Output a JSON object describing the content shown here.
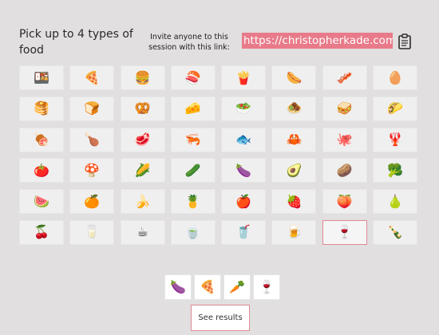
{
  "header": {
    "title": "Pick up to 4 types of food",
    "invite_text": "Invite anyone to this session with this link:",
    "link": "https://christopherkade.com",
    "copy_icon": "clipboard-icon"
  },
  "foods": [
    {
      "name": "bento-box",
      "emoji": "🍱"
    },
    {
      "name": "pizza",
      "emoji": "🍕"
    },
    {
      "name": "hamburger",
      "emoji": "🍔"
    },
    {
      "name": "sushi",
      "emoji": "🍣"
    },
    {
      "name": "french-fries",
      "emoji": "🍟"
    },
    {
      "name": "hot-dog",
      "emoji": "🌭"
    },
    {
      "name": "bacon",
      "emoji": "🥓"
    },
    {
      "name": "egg",
      "emoji": "🥚"
    },
    {
      "name": "pancakes",
      "emoji": "🥞"
    },
    {
      "name": "bread",
      "emoji": "🍞"
    },
    {
      "name": "pretzel",
      "emoji": "🥨"
    },
    {
      "name": "cheese",
      "emoji": "🧀"
    },
    {
      "name": "salad",
      "emoji": "🥗"
    },
    {
      "name": "falafel",
      "emoji": "🧆"
    },
    {
      "name": "sandwich",
      "emoji": "🥪"
    },
    {
      "name": "taco",
      "emoji": "🌮"
    },
    {
      "name": "meat-on-bone",
      "emoji": "🍖"
    },
    {
      "name": "poultry-leg",
      "emoji": "🍗"
    },
    {
      "name": "cut-of-meat",
      "emoji": "🥩"
    },
    {
      "name": "shrimp",
      "emoji": "🦐"
    },
    {
      "name": "fish",
      "emoji": "🐟"
    },
    {
      "name": "crab",
      "emoji": "🦀"
    },
    {
      "name": "octopus",
      "emoji": "🐙"
    },
    {
      "name": "lobster",
      "emoji": "🦞"
    },
    {
      "name": "tomato",
      "emoji": "🍅"
    },
    {
      "name": "mushroom",
      "emoji": "🍄"
    },
    {
      "name": "corn",
      "emoji": "🌽"
    },
    {
      "name": "cucumber",
      "emoji": "🥒"
    },
    {
      "name": "eggplant",
      "emoji": "🍆"
    },
    {
      "name": "avocado",
      "emoji": "🥑"
    },
    {
      "name": "potato",
      "emoji": "🥔"
    },
    {
      "name": "broccoli",
      "emoji": "🥦"
    },
    {
      "name": "watermelon",
      "emoji": "🍉"
    },
    {
      "name": "tangerine",
      "emoji": "🍊"
    },
    {
      "name": "banana",
      "emoji": "🍌"
    },
    {
      "name": "pineapple",
      "emoji": "🍍"
    },
    {
      "name": "apple",
      "emoji": "🍎"
    },
    {
      "name": "strawberry",
      "emoji": "🍓"
    },
    {
      "name": "peach",
      "emoji": "🍑"
    },
    {
      "name": "pear",
      "emoji": "🍐"
    },
    {
      "name": "cherries",
      "emoji": "🍒"
    },
    {
      "name": "glass-of-milk",
      "emoji": "🥛"
    },
    {
      "name": "hot-beverage",
      "emoji": "☕"
    },
    {
      "name": "matcha",
      "emoji": "🍵"
    },
    {
      "name": "tropical-drink",
      "emoji": "🥤"
    },
    {
      "name": "beer-mug",
      "emoji": "🍺"
    },
    {
      "name": "wine-glass",
      "emoji": "🍷",
      "selected": true
    },
    {
      "name": "champagne",
      "emoji": "🍾"
    }
  ],
  "selected": [
    {
      "name": "eggplant",
      "emoji": "🍆"
    },
    {
      "name": "pizza",
      "emoji": "🍕"
    },
    {
      "name": "carrot",
      "emoji": "🥕"
    },
    {
      "name": "wine-glass",
      "emoji": "🍷"
    }
  ],
  "results_button": "See results",
  "colors": {
    "accent": "#e87a89",
    "selected_border": "#e08a94",
    "background": "#e1dfdf",
    "tile": "#efefef"
  }
}
